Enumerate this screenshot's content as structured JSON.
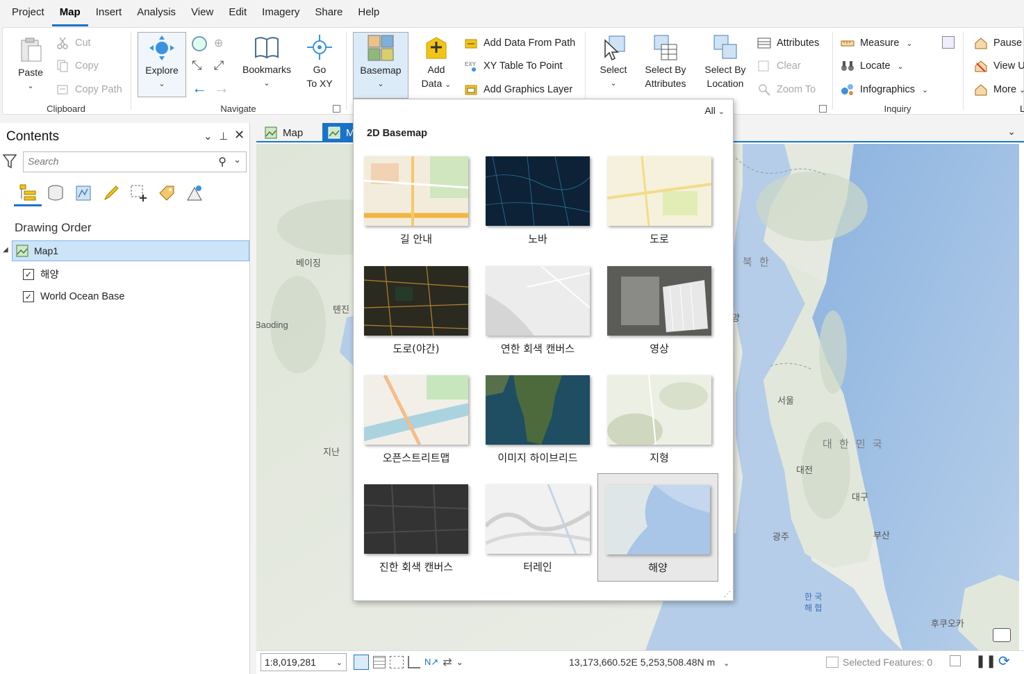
{
  "menu": {
    "items": [
      "Project",
      "Map",
      "Insert",
      "Analysis",
      "View",
      "Edit",
      "Imagery",
      "Share",
      "Help"
    ],
    "active": "Map"
  },
  "ribbon": {
    "clipboard": {
      "label": "Clipboard",
      "paste": "Paste",
      "cut": "Cut",
      "copy": "Copy",
      "copy_path": "Copy Path"
    },
    "navigate": {
      "label": "Navigate",
      "explore": "Explore",
      "bookmarks": "Bookmarks",
      "go_to_xy": "Go To XY",
      "go_to_xy_line1": "Go",
      "go_to_xy_line2": "To XY"
    },
    "layer": {
      "basemap": "Basemap",
      "add_data_line1": "Add",
      "add_data_line2": "Data",
      "add_data_from_path": "Add Data From Path",
      "xy_table_to_point": "XY Table To Point",
      "add_graphics_layer": "Add Graphics Layer"
    },
    "selection": {
      "select": "Select",
      "select_by_attributes_line1": "Select By",
      "select_by_attributes_line2": "Attributes",
      "select_by_location_line1": "Select By",
      "select_by_location_line2": "Location",
      "attributes": "Attributes",
      "clear": "Clear",
      "zoom_to": "Zoom To"
    },
    "inquiry": {
      "label": "Inquiry",
      "measure": "Measure",
      "locate": "Locate",
      "infographics": "Infographics"
    },
    "labeling": {
      "label": "La",
      "pause": "Pause",
      "view_u": "View U",
      "more": "More"
    }
  },
  "contents": {
    "title": "Contents",
    "search_placeholder": "Search",
    "drawing_order": "Drawing Order",
    "map_name": "Map1",
    "layers": [
      {
        "name": "해양",
        "checked": true
      },
      {
        "name": "World Ocean Base",
        "checked": true
      }
    ]
  },
  "map_tabs": [
    {
      "label": "Map",
      "selected": false
    },
    {
      "label": "M",
      "selected": true
    }
  ],
  "map_labels": {
    "beijing": "베이징",
    "tianjin": "톈진",
    "baoding": "Baoding",
    "jinan": "지난",
    "north_korea": "북 한",
    "seoul": "서울",
    "south_korea": "대 한 민 국",
    "daejeon": "대전",
    "daegu": "대구",
    "gwangju": "광주",
    "busan": "부산",
    "korea_strait_line1": "한 국",
    "korea_strait_line2": "해 협",
    "fukuoka": "후쿠오카",
    "yang": "양"
  },
  "status": {
    "scale": "1:8,019,281",
    "coordinates": "13,173,660.52E 5,253,508.48N m",
    "selected_features": "Selected Features: 0"
  },
  "basemap_gallery": {
    "filter": "All",
    "section_title": "2D Basemap",
    "selected": "해양",
    "tiles": [
      {
        "label": "길 안내",
        "theme": "streets"
      },
      {
        "label": "노바",
        "theme": "nova"
      },
      {
        "label": "도로",
        "theme": "light-streets"
      },
      {
        "label": "도로(야간)",
        "theme": "streets-night"
      },
      {
        "label": "연한 회색 캔버스",
        "theme": "light-gray"
      },
      {
        "label": "영상",
        "theme": "imagery"
      },
      {
        "label": "오픈스트리트맵",
        "theme": "osm"
      },
      {
        "label": "이미지 하이브리드",
        "theme": "hybrid"
      },
      {
        "label": "지형",
        "theme": "terrain"
      },
      {
        "label": "진한 회색 캔버스",
        "theme": "dark-gray"
      },
      {
        "label": "터레인",
        "theme": "relief"
      },
      {
        "label": "해양",
        "theme": "oceans"
      }
    ]
  },
  "colors": {
    "accent": "#1a73c9",
    "selected_row": "#cce4f7",
    "sea": "#a9c6e6",
    "land": "#e6e9e1"
  }
}
